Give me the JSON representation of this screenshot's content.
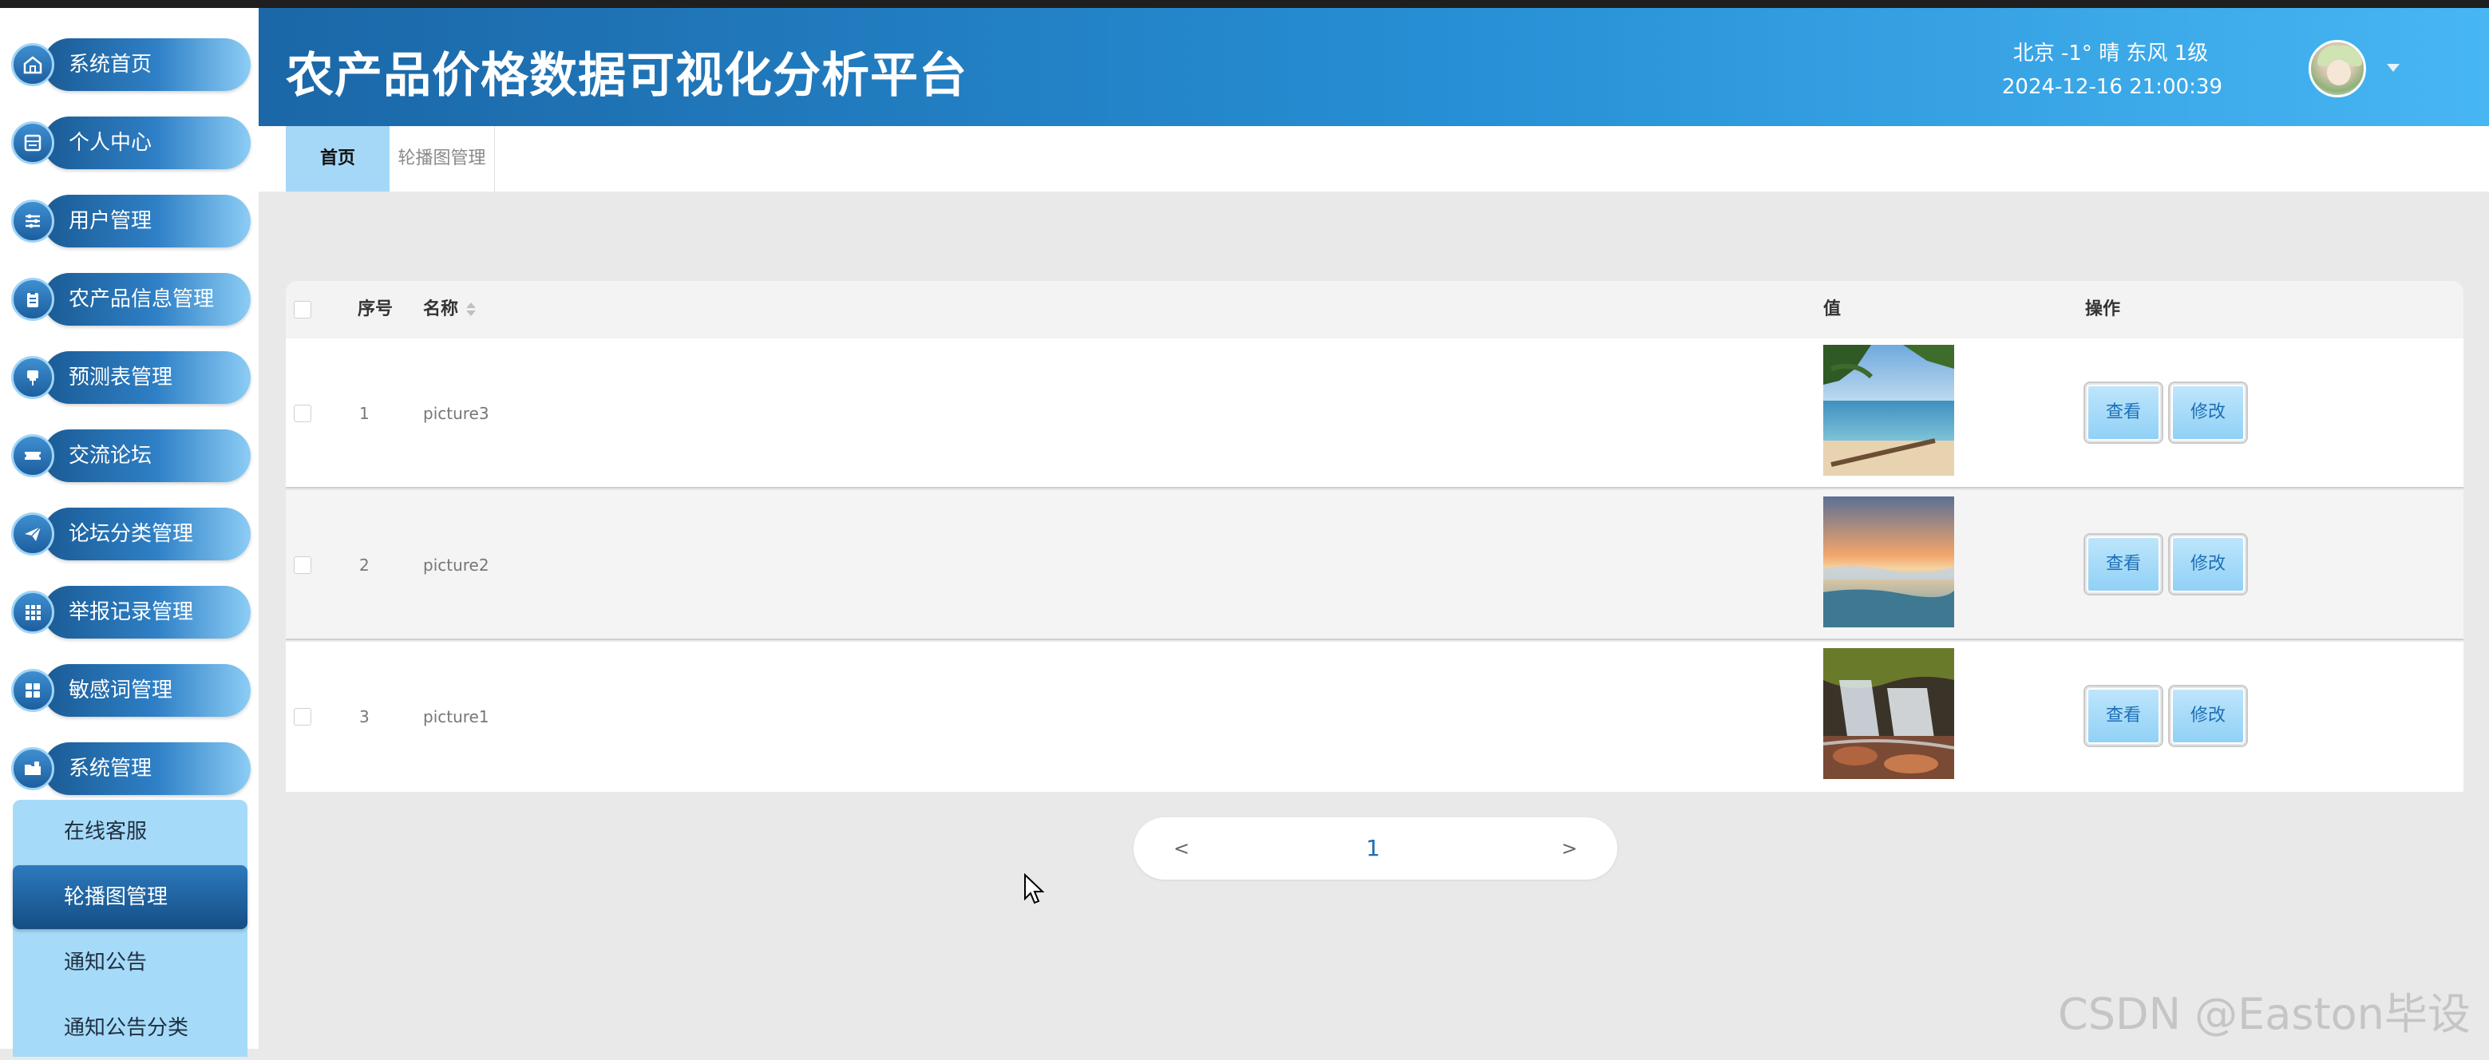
{
  "header": {
    "app_title": "农产品价格数据可视化分析平台",
    "weather": "北京 -1° 晴 东风 1级",
    "datetime": "2024-12-16 21:00:39"
  },
  "sidebar": {
    "items": [
      {
        "label": "系统首页",
        "icon": "home-icon"
      },
      {
        "label": "个人中心",
        "icon": "profile-card-icon"
      },
      {
        "label": "用户管理",
        "icon": "sliders-icon"
      },
      {
        "label": "农产品信息管理",
        "icon": "clipboard-icon"
      },
      {
        "label": "预测表管理",
        "icon": "pin-icon"
      },
      {
        "label": "交流论坛",
        "icon": "ticket-icon"
      },
      {
        "label": "论坛分类管理",
        "icon": "paper-plane-icon"
      },
      {
        "label": "举报记录管理",
        "icon": "grid-icon"
      },
      {
        "label": "敏感词管理",
        "icon": "apps-icon"
      },
      {
        "label": "系统管理",
        "icon": "folder-icon"
      }
    ],
    "submenu": [
      {
        "label": "在线客服"
      },
      {
        "label": "轮播图管理"
      },
      {
        "label": "通知公告"
      },
      {
        "label": "通知公告分类"
      }
    ]
  },
  "tabs": [
    {
      "label": "首页"
    },
    {
      "label": "轮播图管理"
    }
  ],
  "table": {
    "headers": {
      "num": "序号",
      "name": "名称",
      "value": "值",
      "actions": "操作"
    },
    "rows": [
      {
        "num": "1",
        "name": "picture3",
        "thumb": "beach"
      },
      {
        "num": "2",
        "name": "picture2",
        "thumb": "sunset-sea"
      },
      {
        "num": "3",
        "name": "picture1",
        "thumb": "waterfall"
      }
    ],
    "view_label": "查看",
    "edit_label": "修改"
  },
  "pagination": {
    "prev": "<",
    "current": "1",
    "next": ">"
  },
  "watermark": "CSDN @Easton毕设",
  "colors": {
    "header_gradient_start": "#1b67a7",
    "header_gradient_end": "#47b6f2",
    "accent_light": "#a5d8f7",
    "accent_dark": "#1a5b95"
  }
}
